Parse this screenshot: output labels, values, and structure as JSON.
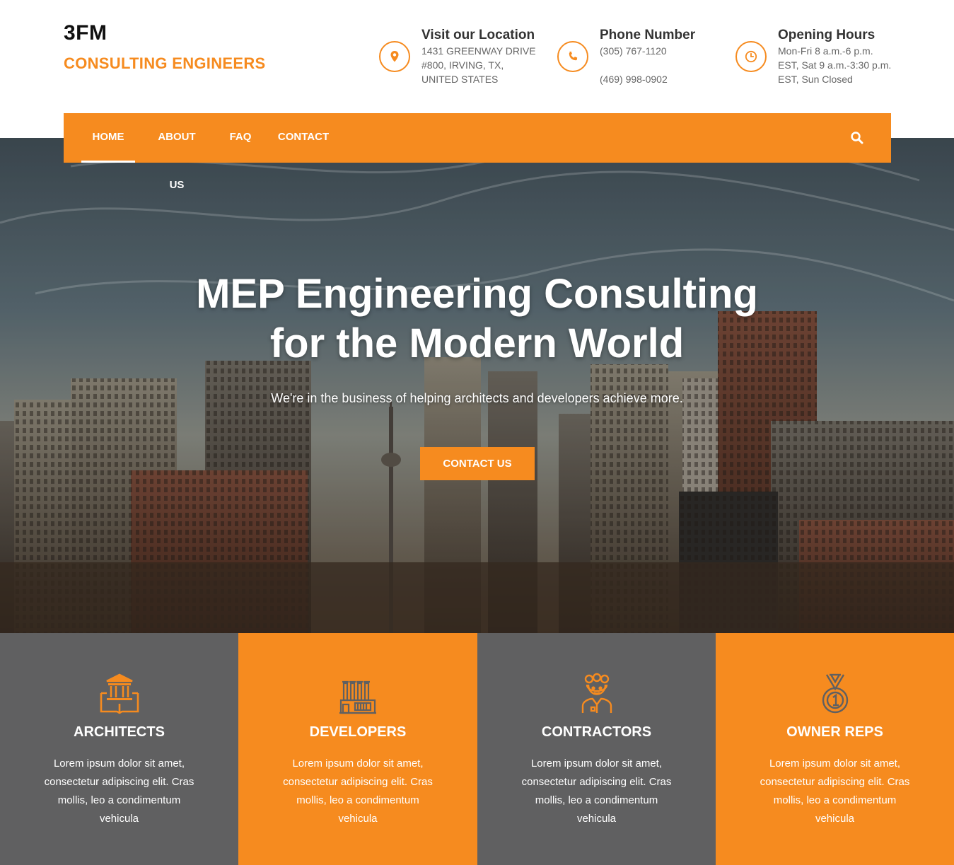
{
  "brand": {
    "name": "3FM",
    "tagline": "CONSULTING ENGINEERS"
  },
  "contact_info": [
    {
      "icon": "map-pin-icon",
      "title": "Visit our Location",
      "lines": [
        "1431 GREENWAY DRIVE",
        "#800, IRVING, TX,",
        "UNITED STATES"
      ]
    },
    {
      "icon": "phone-icon",
      "title": "Phone Number",
      "lines": [
        "(305) 767-1120",
        "",
        "(469) 998-0902"
      ]
    },
    {
      "icon": "clock-icon",
      "title": "Opening Hours",
      "lines": [
        "Mon-Fri 8 a.m.-6 p.m.",
        "EST, Sat 9 a.m.-3:30 p.m.",
        "EST, Sun Closed"
      ]
    }
  ],
  "nav": {
    "items": [
      {
        "label": "HOME",
        "active": true
      },
      {
        "label": "ABOUT US",
        "active": false
      },
      {
        "label": "FAQ",
        "active": false
      },
      {
        "label": "CONTACT",
        "active": false
      }
    ],
    "search_icon": "search-icon"
  },
  "hero": {
    "title_line1": "MEP Engineering Consulting",
    "title_line2": "for the Modern World",
    "subtitle": "We're in the business of helping architects and developers achieve more.",
    "button": "CONTACT US"
  },
  "features": [
    {
      "icon": "bank-book-icon",
      "title": "ARCHITECTS",
      "desc": "Lorem ipsum dolor sit amet, consectetur adipiscing elit. Cras mollis, leo a condimentum vehicula",
      "theme": "gray"
    },
    {
      "icon": "factory-icon",
      "title": "DEVELOPERS",
      "desc": "Lorem ipsum dolor sit amet, consectetur adipiscing elit. Cras mollis, leo a condimentum vehicula",
      "theme": "orange"
    },
    {
      "icon": "engineer-icon",
      "title": "CONTRACTORS",
      "desc": "Lorem ipsum dolor sit amet, consectetur adipiscing elit. Cras mollis, leo a condimentum vehicula",
      "theme": "gray"
    },
    {
      "icon": "medal-icon",
      "title": "OWNER REPS",
      "desc": "Lorem ipsum dolor sit amet, consectetur adipiscing elit. Cras mollis, leo a condimentum vehicula",
      "theme": "orange"
    }
  ],
  "colors": {
    "accent": "#f68b1f",
    "gray": "#606061",
    "text_dark": "#333333"
  }
}
